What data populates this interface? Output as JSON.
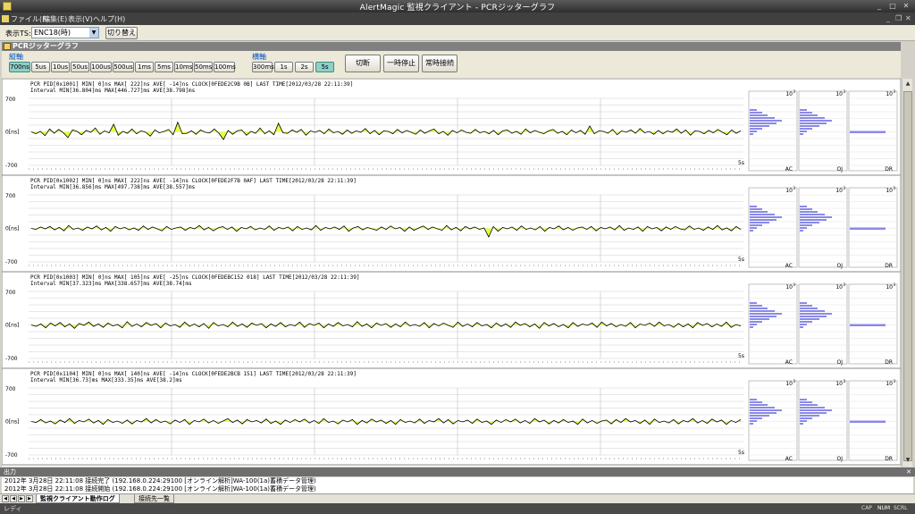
{
  "window": {
    "title": "AlertMagic 監視クライアント - PCRジッターグラフ"
  },
  "menu": [
    "ファイル(F)",
    "編集(E)",
    "表示(V)",
    "ヘルプ(H)"
  ],
  "toolbar": {
    "ts_label": "表示TS:",
    "ts_value": "ENC18(時)",
    "switch_label": "切り替え"
  },
  "doc": {
    "title": "PCRジッターグラフ"
  },
  "controls": {
    "vaxis_label": "縦軸",
    "vaxis": [
      "700ns",
      "5us",
      "10us",
      "50us",
      "100us",
      "500us",
      "1ms",
      "5ms",
      "10ms",
      "50ms",
      "100ms"
    ],
    "vaxis_selected": 0,
    "haxis_label": "横軸",
    "haxis": [
      "300ms",
      "1s",
      "2s",
      "5s"
    ],
    "haxis_selected": 3,
    "disconnect": "切断",
    "pause": "一時停止",
    "always_connect": "常時接続"
  },
  "graph_common": {
    "y_top": "700",
    "y_mid": "0[ns]",
    "y_bot": "-700",
    "x_end": "5s",
    "hist_max": "10",
    "hist_exp": "3",
    "hist_labels": [
      "AC",
      "OJ",
      "DR"
    ]
  },
  "graphs": [
    {
      "line1": "PCR PID[0x1001] MIN[   0]ns MAX[ 222]ns AVE[ -14]ns CLOCK[0FEDE2C9B 0B] LAST TIME[2012/03/28 22:11:39]",
      "line2": "Interval MIN[36.804]ms MAX[446.727]ms AVE[38.798]ms",
      "jitter_ns": [
        0,
        -40,
        10,
        -80,
        60,
        -30,
        50,
        -20,
        -120,
        40,
        10,
        -60,
        30,
        -10,
        80,
        -50,
        20,
        -20,
        160,
        -70,
        10,
        -30,
        60,
        -40,
        20,
        -10,
        -90,
        40,
        -20,
        10,
        50,
        -60,
        200,
        -40,
        -30,
        20,
        -50,
        40,
        -10,
        -20,
        60,
        -30,
        -160,
        30,
        -50,
        20,
        40,
        -70,
        10,
        -30,
        80,
        -40,
        20,
        -60,
        180,
        -20,
        -30,
        40,
        -10,
        50,
        -70,
        20,
        -10,
        30,
        -40,
        60,
        -20,
        10,
        -50,
        40,
        -30,
        20,
        -10,
        70,
        -40,
        30,
        -60,
        20,
        10,
        -40,
        50,
        -20,
        30,
        -10,
        -50,
        40,
        -30,
        20,
        60,
        -40,
        10,
        -70,
        30,
        -20,
        40,
        -10,
        -30,
        50,
        -20,
        10,
        -40,
        30,
        -60,
        20,
        40,
        -30,
        10,
        -50,
        60,
        -20,
        30,
        -10,
        -40,
        20,
        50,
        -30,
        10,
        -60,
        40,
        -20,
        30,
        -50,
        120,
        -40,
        20,
        10,
        -30,
        50,
        -60,
        20,
        -10,
        40,
        -30,
        70,
        -20,
        10,
        -50,
        30,
        -40,
        20,
        -10,
        60,
        -30,
        40,
        -70,
        20,
        10,
        -40,
        30,
        -20,
        50,
        -10,
        -60,
        40,
        -30,
        20
      ]
    },
    {
      "line1": "PCR PID[0x1002] MIN[   0]ns MAX[ 222]ns AVE[ -14]ns CLOCK[0FEDE2F7B 0AF] LAST TIME[2012/03/28 22:11:39]",
      "line2": "Interval MIN[36.856]ms MAX[497.738]ms AVE[38.557]ms",
      "jitter_ns": [
        0,
        -20,
        30,
        -10,
        40,
        -30,
        20,
        -50,
        60,
        -20,
        10,
        -40,
        30,
        -10,
        50,
        -30,
        20,
        -60,
        40,
        -10,
        20,
        -30,
        10,
        -40,
        50,
        -20,
        30,
        -10,
        -50,
        40,
        -20,
        10,
        30,
        -40,
        20,
        -10,
        60,
        -30,
        20,
        -50,
        10,
        40,
        -20,
        30,
        -60,
        20,
        -10,
        40,
        -30,
        10,
        -20,
        50,
        -40,
        20,
        -10,
        30,
        -50,
        40,
        -20,
        10,
        -30,
        60,
        -40,
        20,
        -10,
        30,
        -20,
        50,
        -60,
        10,
        40,
        -30,
        20,
        -10,
        -40,
        30,
        -20,
        50,
        -10,
        20,
        -60,
        30,
        -40,
        10,
        50,
        -20,
        30,
        -10,
        -40,
        60,
        -30,
        20,
        -50,
        40,
        -10,
        30,
        -20,
        10,
        -180,
        40,
        -60,
        20,
        -10,
        30,
        -40,
        50,
        -20,
        10,
        -30,
        40,
        -60,
        20,
        -10,
        50,
        -30,
        20,
        -40,
        10,
        30,
        -20,
        40,
        -50,
        20,
        -10,
        30,
        -30,
        60,
        -40,
        10,
        -20,
        30,
        -60,
        40,
        -10,
        20,
        -50,
        30,
        -20,
        40,
        -10,
        -30,
        50,
        -20,
        10,
        -40,
        30,
        -20,
        60,
        -30,
        10,
        -50,
        40,
        -20
      ]
    },
    {
      "line1": "PCR PID[0x1003] MIN[   0]ns MAX[ 105]ns AVE[ -25]ns CLOCK[0FEDEBC152 018] LAST TIME[2012/03/28 22:11:39]",
      "line2": "Interval MIN[37.323]ms MAX[338.657]ms AVE[38.74]ms",
      "jitter_ns": [
        0,
        -30,
        20,
        -60,
        40,
        -20,
        50,
        -40,
        20,
        -70,
        30,
        -10,
        60,
        -30,
        20,
        -50,
        40,
        -20,
        10,
        -60,
        70,
        -30,
        20,
        -40,
        50,
        -10,
        30,
        -60,
        40,
        -20,
        10,
        -50,
        60,
        -30,
        20,
        -40,
        30,
        -70,
        50,
        -20,
        10,
        -40,
        60,
        -30,
        20,
        -50,
        40,
        -10,
        30,
        -60,
        20,
        -30,
        50,
        -40,
        10,
        -20,
        60,
        -50,
        30,
        -10,
        40,
        -60,
        20,
        -30,
        50,
        -20,
        10,
        -40,
        70,
        -30,
        20,
        -60,
        40,
        -10,
        30,
        -50,
        20,
        -40,
        60,
        -20,
        10,
        -30,
        50,
        -60,
        30,
        -20,
        40,
        -10,
        -50,
        60,
        -30,
        20,
        -40,
        50,
        -20,
        10,
        -60,
        40,
        -30,
        20,
        -50,
        60,
        -10,
        30,
        -40,
        20,
        -70,
        50,
        -20,
        30,
        -40,
        10,
        -60,
        50,
        -30,
        20,
        -10,
        40,
        -50,
        60,
        -20,
        30,
        -40,
        10,
        -30,
        50,
        -60,
        20,
        -10,
        40,
        -30,
        60,
        -20,
        10,
        -50,
        30,
        -40,
        20,
        -60,
        50,
        -10,
        30,
        -40,
        20,
        -30,
        60,
        -50,
        10,
        -20
      ]
    },
    {
      "line1": "PCR PID[0x1104] MIN[   0]ns MAX[ 140]ns AVE[ -14]ns CLOCK[0FEDE2BCB 151] LAST TIME[2012/03/28 22:11:39]",
      "line2": "Interval MIN[36.73]ms MAX[333.35]ms AVE[38.2]ms",
      "jitter_ns": [
        0,
        -20,
        40,
        -30,
        10,
        -50,
        30,
        -20,
        60,
        -40,
        20,
        -10,
        50,
        -30,
        20,
        -60,
        40,
        -20,
        10,
        -40,
        30,
        -50,
        20,
        -10,
        60,
        -30,
        40,
        -20,
        10,
        -50,
        30,
        -20,
        40,
        -60,
        20,
        -10,
        50,
        -30,
        20,
        -40,
        10,
        60,
        -20,
        30,
        -50,
        40,
        -10,
        20,
        -30,
        50,
        -40,
        10,
        -60,
        30,
        -20,
        40,
        -10,
        50,
        -30,
        20,
        -40,
        60,
        -20,
        10,
        -50,
        30,
        -10,
        40,
        -60,
        20,
        -30,
        50,
        -10,
        30,
        -40,
        20,
        -60,
        40,
        -20,
        10,
        -30,
        50,
        -40,
        20,
        -10,
        60,
        -30,
        40,
        -50,
        20,
        -10,
        30,
        -40,
        50,
        -20,
        10,
        -60,
        30,
        -20,
        40,
        -10,
        50,
        -30,
        20,
        -40,
        60,
        -10,
        30,
        -50,
        20,
        -30,
        40,
        -20,
        10,
        -60,
        50,
        -30,
        20,
        -40,
        10,
        30,
        -50,
        40,
        -20,
        60,
        -10,
        20,
        -40,
        30,
        -60,
        50,
        -20,
        10,
        -30,
        40,
        -50,
        20,
        -10,
        60,
        -30,
        20,
        -40,
        50,
        -10,
        30,
        -60,
        20,
        -20,
        40
      ]
    }
  ],
  "output": {
    "title": "出力",
    "lines": [
      "2012年 3月28日  22:11:08  接続完了 (192.168.0.224:29100 [オンライン解析]WA-100(1a)蓄積データ管理)",
      "2012年 3月28日  22:11:08  接続開始 (192.168.0.224:29100 [オンライン解析]WA-100(1a)蓄積データ管理)"
    ],
    "tabs": [
      "監視クライアント動作ログ",
      "接続先一覧"
    ]
  },
  "status": {
    "text": "レディ",
    "indicators": [
      "CAP",
      "NUM",
      "SCRL"
    ]
  },
  "colors": {
    "jitter_fill": "#e8ff40",
    "jitter_line": "#000000",
    "histogram": "#8a8ae8",
    "grid": "#cfcfcf"
  }
}
